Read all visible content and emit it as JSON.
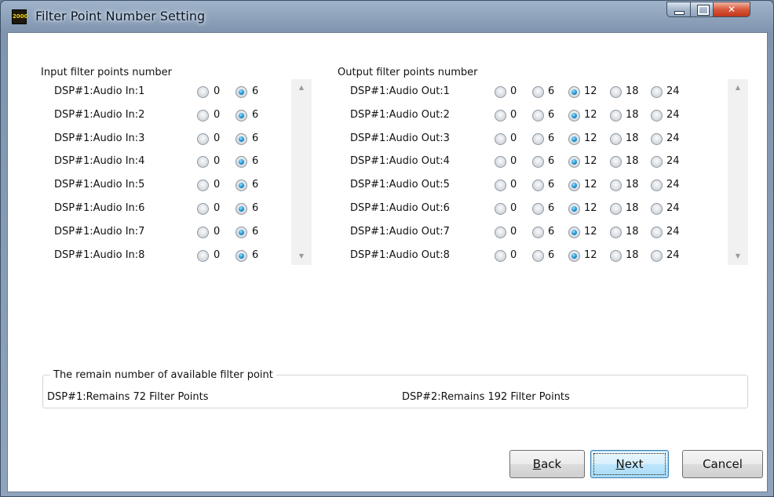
{
  "window": {
    "title": "Filter Point Number Setting",
    "app_icon_text": "2000"
  },
  "input_section": {
    "title": "Input filter points number",
    "option_values": [
      "0",
      "6"
    ],
    "rows": [
      {
        "label": "DSP#1:Audio In:1",
        "selected": "6"
      },
      {
        "label": "DSP#1:Audio In:2",
        "selected": "6"
      },
      {
        "label": "DSP#1:Audio In:3",
        "selected": "6"
      },
      {
        "label": "DSP#1:Audio In:4",
        "selected": "6"
      },
      {
        "label": "DSP#1:Audio In:5",
        "selected": "6"
      },
      {
        "label": "DSP#1:Audio In:6",
        "selected": "6"
      },
      {
        "label": "DSP#1:Audio In:7",
        "selected": "6"
      },
      {
        "label": "DSP#1:Audio In:8",
        "selected": "6"
      }
    ]
  },
  "output_section": {
    "title": "Output filter points number",
    "option_values": [
      "0",
      "6",
      "12",
      "18",
      "24"
    ],
    "rows": [
      {
        "label": "DSP#1:Audio Out:1",
        "selected": "12"
      },
      {
        "label": "DSP#1:Audio Out:2",
        "selected": "12"
      },
      {
        "label": "DSP#1:Audio Out:3",
        "selected": "12"
      },
      {
        "label": "DSP#1:Audio Out:4",
        "selected": "12"
      },
      {
        "label": "DSP#1:Audio Out:5",
        "selected": "12"
      },
      {
        "label": "DSP#1:Audio Out:6",
        "selected": "12"
      },
      {
        "label": "DSP#1:Audio Out:7",
        "selected": "12"
      },
      {
        "label": "DSP#1:Audio Out:8",
        "selected": "12"
      }
    ]
  },
  "remain_group": {
    "title": "The remain number of available filter point",
    "dsp1_text": "DSP#1:Remains 72 Filter Points",
    "dsp2_text": "DSP#2:Remains 192 Filter Points"
  },
  "buttons": {
    "back_mnemonic": "B",
    "back_rest": "ack",
    "next_mnemonic": "N",
    "next_rest": "ext",
    "cancel": "Cancel"
  },
  "colors": {
    "accent_radio": "#1a8fd1",
    "title_bar": "#8fa4bc",
    "close_button": "#c0371a"
  }
}
